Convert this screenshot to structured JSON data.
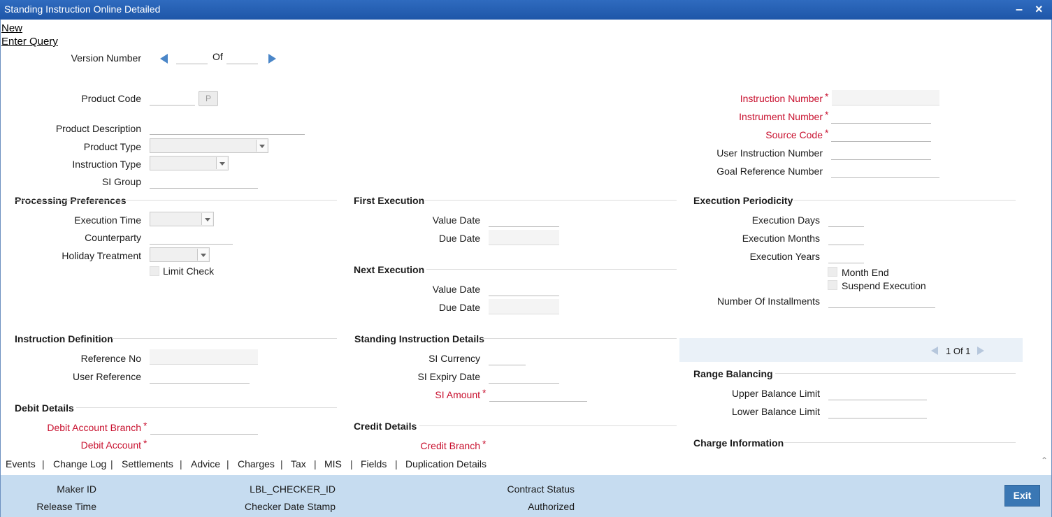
{
  "window": {
    "title": "Standing Instruction Online Detailed"
  },
  "actions": {
    "new": "New",
    "enter_query": "Enter Query"
  },
  "version": {
    "label": "Version Number",
    "of": "Of"
  },
  "product": {
    "code_label": "Product Code",
    "code_button": "P",
    "description_label": "Product Description",
    "type_label": "Product Type",
    "instruction_type_label": "Instruction Type",
    "si_group_label": "SI Group"
  },
  "right_top": {
    "instruction_number": "Instruction Number",
    "instrument_number": "Instrument Number",
    "source_code": "Source Code",
    "user_instruction_number": "User Instruction Number",
    "goal_reference_number": "Goal Reference Number"
  },
  "processing": {
    "title": "Processing Preferences",
    "execution_time": "Execution Time",
    "counterparty": "Counterparty",
    "holiday_treatment": "Holiday Treatment",
    "limit_check": "Limit Check"
  },
  "first_execution": {
    "title": "First Execution",
    "value_date": "Value Date",
    "due_date": "Due Date"
  },
  "next_execution": {
    "title": "Next Execution",
    "value_date": "Value Date",
    "due_date": "Due Date"
  },
  "periodicity": {
    "title": "Execution Periodicity",
    "days": "Execution Days",
    "months": "Execution Months",
    "years": "Execution Years",
    "month_end": "Month End",
    "suspend": "Suspend Execution",
    "installments": "Number Of Installments"
  },
  "instruction_def": {
    "title": "Instruction Definition",
    "reference_no": "Reference No",
    "user_reference": "User Reference"
  },
  "si_details": {
    "title": "Standing Instruction Details",
    "currency": "SI Currency",
    "expiry": "SI Expiry Date",
    "amount": "SI Amount"
  },
  "pager": {
    "text": "1 Of 1"
  },
  "range_balancing": {
    "title": "Range Balancing",
    "upper": "Upper Balance Limit",
    "lower": "Lower Balance Limit"
  },
  "debit": {
    "title": "Debit Details",
    "branch": "Debit Account Branch",
    "account": "Debit Account"
  },
  "credit": {
    "title": "Credit Details",
    "branch": "Credit Branch"
  },
  "charge": {
    "title": "Charge Information"
  },
  "tabs": [
    "Events",
    "Change Log",
    "Settlements",
    "Advice",
    "Charges",
    "Tax",
    "MIS",
    "Fields",
    "Duplication Details"
  ],
  "footer": {
    "maker_id": "Maker ID",
    "release_time": "Release Time",
    "checker_id": "LBL_CHECKER_ID",
    "checker_stamp": "Checker Date Stamp",
    "contract_status": "Contract Status",
    "authorized": "Authorized",
    "exit": "Exit"
  },
  "colors": {
    "title_bar": "#1e56a8",
    "required": "#c8102e",
    "footer": "#c6dcf0",
    "exit_button": "#3a77b4"
  }
}
